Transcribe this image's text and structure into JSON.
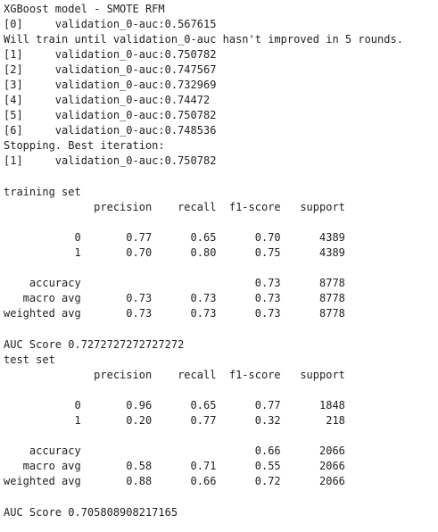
{
  "log": {
    "header": "XGBoost model - SMOTE RFM",
    "round0": "[0]\tvalidation_0-auc:0.567615",
    "will_train": "Will train until validation_0-auc hasn't improved in 5 rounds.",
    "round1": "[1]\tvalidation_0-auc:0.750782",
    "round2": "[2]\tvalidation_0-auc:0.747567",
    "round3": "[3]\tvalidation_0-auc:0.732969",
    "round4": "[4]\tvalidation_0-auc:0.74472",
    "round5": "[5]\tvalidation_0-auc:0.750782",
    "round6": "[6]\tvalidation_0-auc:0.748536",
    "stopping": "Stopping. Best iteration:",
    "best": "[1]\tvalidation_0-auc:0.750782"
  },
  "training": {
    "title": "training set",
    "header": "              precision    recall  f1-score   support",
    "row0": "           0       0.77      0.65      0.70      4389",
    "row1": "           1       0.70      0.80      0.75      4389",
    "accuracy": "    accuracy                           0.73      8778",
    "macro": "   macro avg       0.73      0.73      0.73      8778",
    "weighted": "weighted avg       0.73      0.73      0.73      8778",
    "auc": "AUC Score 0.7272727272727272"
  },
  "test": {
    "title": "test set",
    "header": "              precision    recall  f1-score   support",
    "row0": "           0       0.96      0.65      0.77      1848",
    "row1": "           1       0.20      0.77      0.32       218",
    "accuracy": "    accuracy                           0.66      2066",
    "macro": "   macro avg       0.58      0.71      0.55      2066",
    "weighted": "weighted avg       0.88      0.66      0.72      2066",
    "auc": "AUC Score 0.705808908217165"
  }
}
